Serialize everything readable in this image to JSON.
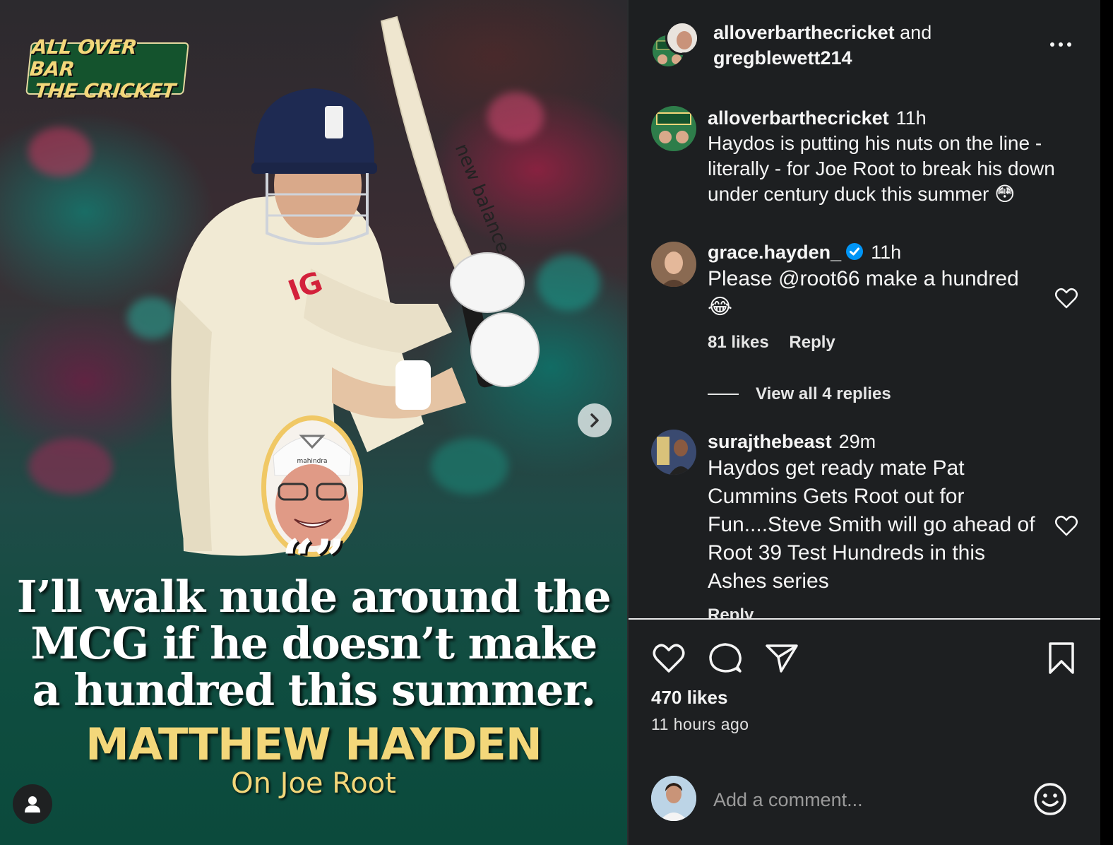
{
  "media": {
    "brand_logo_line1": "ALL OVER BAR",
    "brand_logo_line2": "THE CRICKET",
    "bat_brand": "new balance",
    "shirt_sponsor": "IG",
    "cap_brand": "mahindra",
    "quote_marks": "“”",
    "quote": "I’ll walk nude around the MCG if he doesn’t make a hundred this summer.",
    "author": "MATTHEW HAYDEN",
    "subject": "On Joe Root"
  },
  "header": {
    "author1": "alloverbarthecricket",
    "joiner": "and",
    "author2": "gregblewett214"
  },
  "comments": [
    {
      "user": "alloverbarthecricket",
      "time": "11h",
      "text": "Haydos is putting his nuts on the line - literally - for Joe Root to break his down under century duck this summer 😳"
    },
    {
      "user": "grace.hayden_",
      "verified": true,
      "time": "11h",
      "text": "Please @root66 make a hundred 😂",
      "likes": "81 likes",
      "reply_label": "Reply",
      "view_replies": "View all 4 replies"
    },
    {
      "user": "surajthebeast",
      "time": "29m",
      "text": "Haydos get ready mate Pat Cummins Gets Root out for Fun....Steve Smith will go ahead of Root 39 Test Hundreds in this Ashes series",
      "reply_label": "Reply"
    }
  ],
  "post": {
    "likes": "470 likes",
    "time_ago": "11 hours ago"
  },
  "comment_box": {
    "placeholder": "Add a comment..."
  },
  "icons": {
    "like": "heart-icon",
    "comment": "comment-bubble-icon",
    "share": "paper-plane-icon",
    "save": "bookmark-icon",
    "emoji": "smiley-icon",
    "more": "ellipsis-icon",
    "next": "chevron-right-icon",
    "tagged": "user-icon",
    "verified": "verified-badge-icon"
  },
  "colors": {
    "panel_bg": "#1d1f21",
    "accent_gold": "#f3d77a",
    "verified_blue": "#0095f6",
    "logo_green": "#14532d"
  }
}
